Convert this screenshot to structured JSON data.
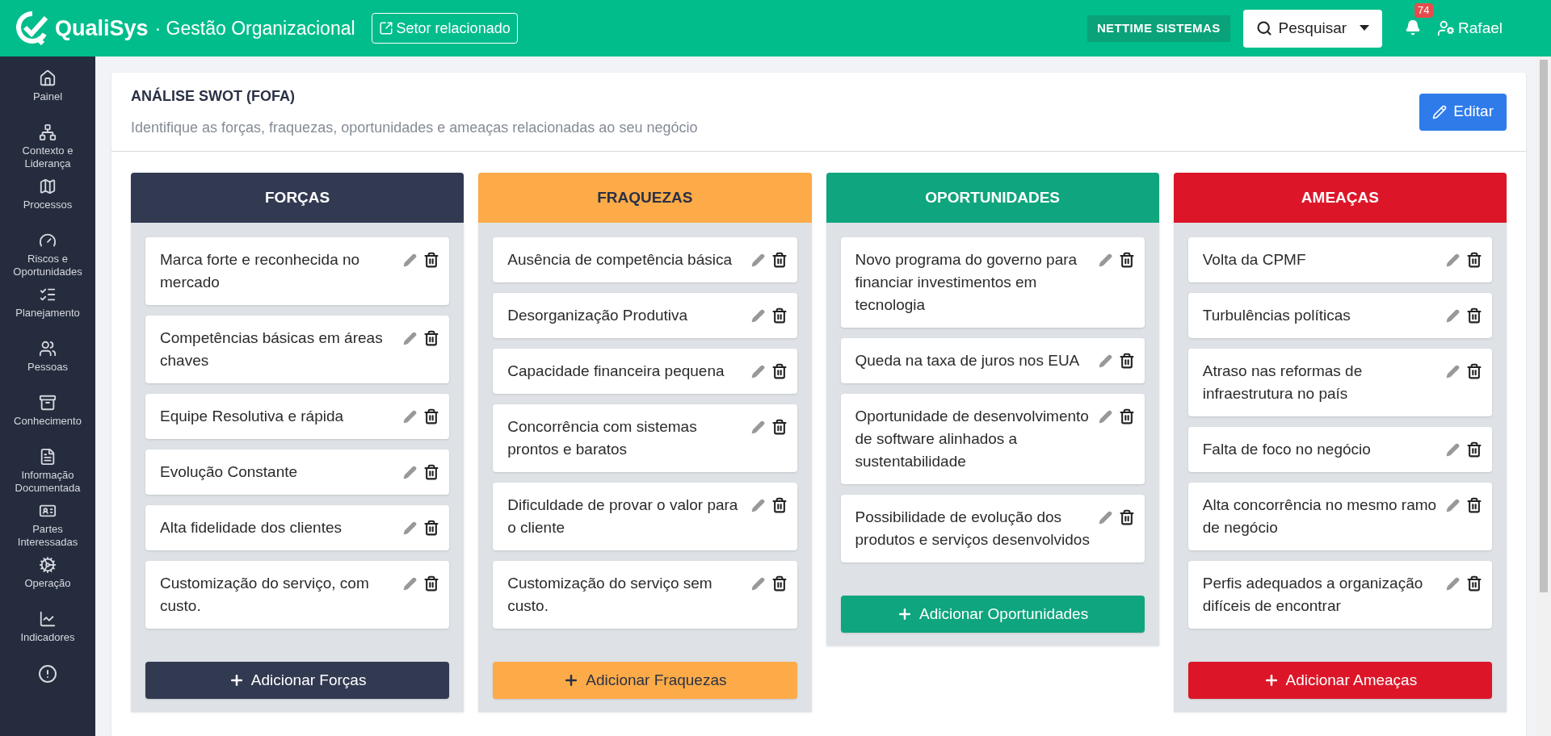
{
  "header": {
    "brand": "QualiSys",
    "subtitle": "· Gestão Organizacional",
    "related_button": "Setor relacionado",
    "company": "NETTIME SISTEMAS",
    "search_button": "Pesquisar",
    "notifications": "74",
    "user": "Rafael"
  },
  "sidebar": {
    "items": [
      {
        "label": "Painel"
      },
      {
        "label": "Contexto e Liderança"
      },
      {
        "label": "Processos"
      },
      {
        "label": "Riscos e Oportunidades"
      },
      {
        "label": "Planejamento"
      },
      {
        "label": "Pessoas"
      },
      {
        "label": "Conhecimento"
      },
      {
        "label": "Informação Documentada"
      },
      {
        "label": "Partes Interessadas"
      },
      {
        "label": "Operação"
      },
      {
        "label": "Indicadores"
      }
    ]
  },
  "page": {
    "title": "ANÁLISE SWOT (FOFA)",
    "description": "Identifique as forças, fraquezas, oportunidades e ameaças relacionadas ao seu negócio",
    "edit_button": "Editar"
  },
  "columns": [
    {
      "title": "FORÇAS",
      "color": "#323a52",
      "items": [
        "Marca forte e reconhecida no mercado",
        "Competências básicas em áreas chaves",
        "Equipe Resolutiva e rápida",
        "Evolução Constante",
        "Alta fidelidade dos clientes",
        "Customização do serviço, com custo."
      ],
      "add_button": "Adicionar Forças"
    },
    {
      "title": "FRAQUEZAS",
      "color": "#fdab48",
      "items": [
        "Ausência de competência básica",
        "Desorganização Produtiva",
        "Capacidade financeira pequena",
        "Concorrência com sistemas prontos e baratos",
        "Dificuldade de provar o valor para o cliente",
        "Customização do serviço sem custo."
      ],
      "add_button": "Adicionar Fraquezas"
    },
    {
      "title": "OPORTUNIDADES",
      "color": "#0fa57e",
      "items": [
        "Novo programa do governo para financiar investimentos em tecnologia",
        "Queda na taxa de juros nos EUA",
        "Oportunidade de desenvolvimento de software alinhados a sustentabilidade",
        "Possibilidade de evolução dos produtos e serviços desenvolvidos"
      ],
      "add_button": "Adicionar Oportunidades"
    },
    {
      "title": "AMEAÇAS",
      "color": "#dc1628",
      "items": [
        "Volta da CPMF",
        "Turbulências políticas",
        "Atraso nas reformas de infraestrutura no país",
        "Falta de foco no negócio",
        "Alta concorrência no mesmo ramo de negócio",
        "Perfis adequados a organização difíceis de encontrar"
      ],
      "add_button": "Adicionar Ameaças"
    }
  ]
}
